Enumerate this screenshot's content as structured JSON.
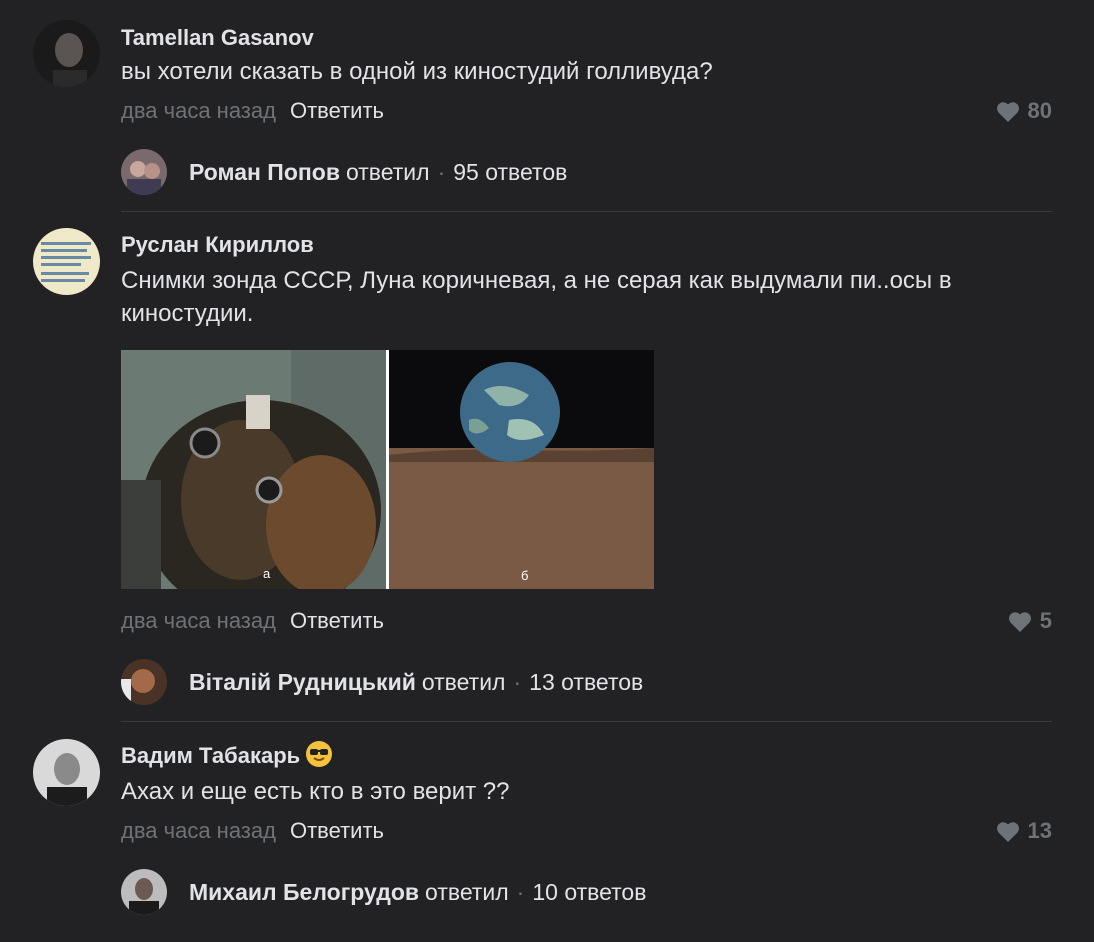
{
  "comments": [
    {
      "author": "Tamellan Gasanov",
      "text": "вы хотели сказать в одной из киностудий голливуда?",
      "time": "два часа назад",
      "reply": "Ответить",
      "likes": "80",
      "thread": {
        "name": "Роман Попов",
        "verb": "ответил",
        "dot": "·",
        "count": "95 ответов"
      }
    },
    {
      "author": "Руслан Кириллов",
      "text": "Снимки зонда СССР, Луна коричневая, а не серая как выдумали пи..осы в киностудии.",
      "time": "два часа назад",
      "reply": "Ответить",
      "likes": "5",
      "photo_labels": [
        "а",
        "б"
      ],
      "thread": {
        "name": "Віталій Рудницький",
        "verb": "ответил",
        "dot": "·",
        "count": "13 ответов"
      }
    },
    {
      "author": "Вадим Табакарь",
      "text": "Ахах и еще есть кто в это верит ??",
      "time": "два часа назад",
      "reply": "Ответить",
      "likes": "13",
      "thread": {
        "name": "Михаил Белогрудов",
        "verb": "ответил",
        "dot": "·",
        "count": "10 ответов"
      }
    }
  ]
}
